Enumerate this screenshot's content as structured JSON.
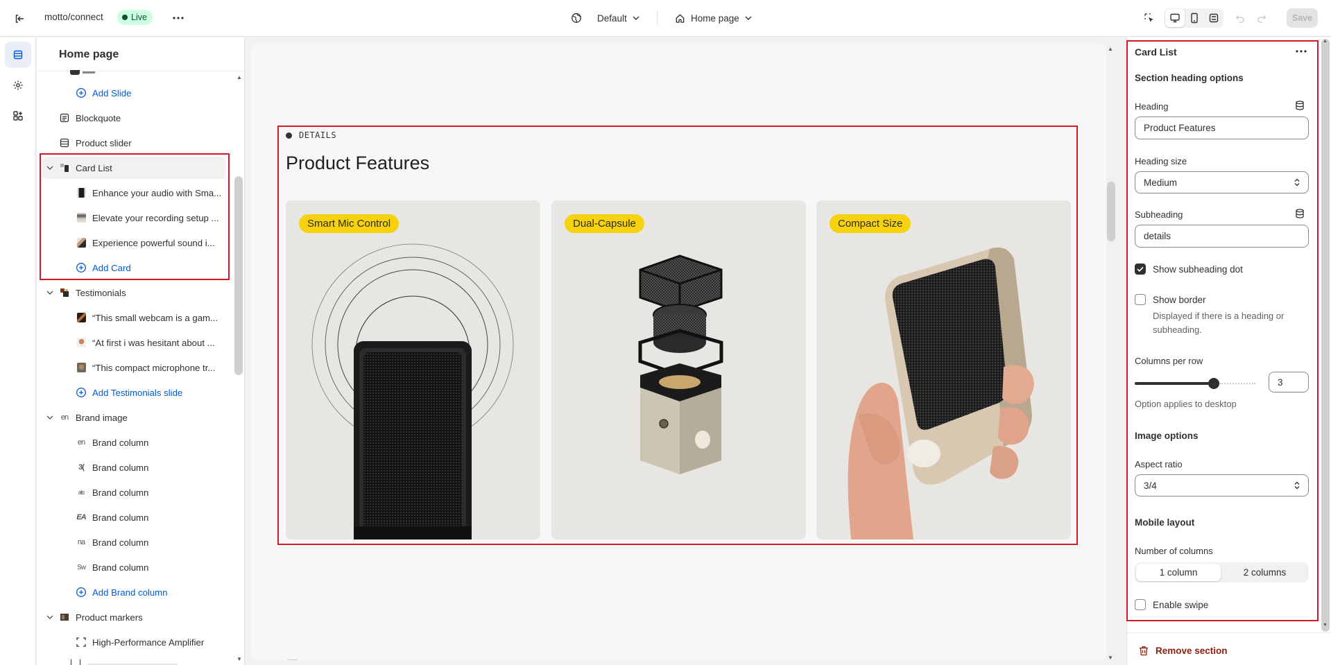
{
  "topbar": {
    "store_name": "motto/connect",
    "status": "Live",
    "theme_label": "Default",
    "page_label": "Home page",
    "save_label": "Save"
  },
  "sidebar": {
    "title": "Home page",
    "items": [
      {
        "label": "Add Slide",
        "type": "add"
      },
      {
        "label": "Blockquote",
        "type": "section"
      },
      {
        "label": "Product slider",
        "type": "section"
      },
      {
        "label": "Card List",
        "type": "section-expanded"
      },
      {
        "label": "Enhance your audio with Sma...",
        "type": "block"
      },
      {
        "label": "Elevate your recording setup ...",
        "type": "block"
      },
      {
        "label": "Experience powerful sound i...",
        "type": "block"
      },
      {
        "label": "Add Card",
        "type": "add"
      },
      {
        "label": "Testimonials",
        "type": "section-expanded"
      },
      {
        "label": "“This small webcam is a gam...",
        "type": "block"
      },
      {
        "label": "“At first i was hesitant about ...",
        "type": "block"
      },
      {
        "label": "“This compact microphone tr...",
        "type": "block"
      },
      {
        "label": "Add Testimonials slide",
        "type": "add"
      },
      {
        "label": "Brand image",
        "type": "section-expanded"
      },
      {
        "label": "Brand column",
        "type": "block",
        "thumb": "en"
      },
      {
        "label": "Brand column",
        "type": "block",
        "thumb": "3("
      },
      {
        "label": "Brand column",
        "type": "block",
        "thumb": "als"
      },
      {
        "label": "Brand column",
        "type": "block",
        "thumb": "EA"
      },
      {
        "label": "Brand column",
        "type": "block",
        "thumb": "na"
      },
      {
        "label": "Brand column",
        "type": "block",
        "thumb": "Sw"
      },
      {
        "label": "Add Brand column",
        "type": "add"
      },
      {
        "label": "Product markers",
        "type": "section-expanded"
      },
      {
        "label": "High-Performance Amplifier",
        "type": "block"
      }
    ]
  },
  "preview": {
    "subheading": "DETAILS",
    "heading": "Product Features",
    "cards": [
      {
        "tag": "Smart Mic Control"
      },
      {
        "tag": "Dual-Capsule"
      },
      {
        "tag": "Compact Size"
      }
    ]
  },
  "settings": {
    "title": "Card List",
    "section_heading_options": "Section heading options",
    "heading_label": "Heading",
    "heading_value": "Product Features",
    "heading_size_label": "Heading size",
    "heading_size_value": "Medium",
    "subheading_label": "Subheading",
    "subheading_value": "details",
    "show_subheading_dot_label": "Show subheading dot",
    "show_subheading_dot": true,
    "show_border_label": "Show border",
    "show_border": false,
    "show_border_help": "Displayed if there is a heading or subheading.",
    "columns_per_row_label": "Columns per row",
    "columns_per_row_value": "3",
    "columns_help": "Option applies to desktop",
    "image_options": "Image options",
    "aspect_ratio_label": "Aspect ratio",
    "aspect_ratio_value": "3/4",
    "mobile_layout": "Mobile layout",
    "number_of_columns_label": "Number of columns",
    "column_options": [
      "1 column",
      "2 columns"
    ],
    "selected_column_option": "1 column",
    "enable_swipe_label": "Enable swipe",
    "enable_swipe": false,
    "remove_section_label": "Remove section"
  },
  "colors": {
    "accent_blue": "#005bd3",
    "highlight_red": "#d11a25",
    "tag_yellow": "#f6d10d",
    "live_green_bg": "#cdfee1",
    "remove_red": "#8e1f0b"
  }
}
